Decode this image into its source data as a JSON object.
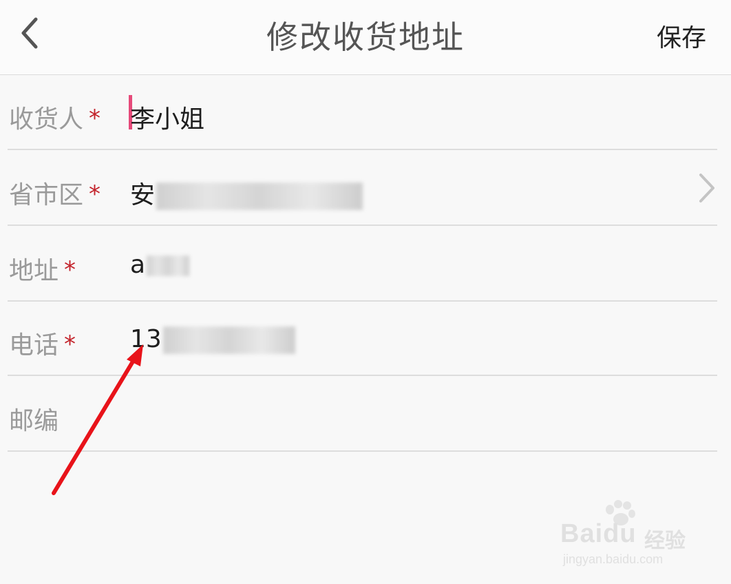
{
  "header": {
    "title": "修改收货地址",
    "save_label": "保存",
    "back_icon": "chevron-left-icon"
  },
  "form": {
    "required_mark": "*",
    "fields": [
      {
        "label": "收货人",
        "required": true,
        "value": "李小姐"
      },
      {
        "label": "省市区",
        "required": true,
        "value": "安",
        "has_chevron": true
      },
      {
        "label": "地址",
        "required": true,
        "value": "a"
      },
      {
        "label": "电话",
        "required": true,
        "value": "13"
      },
      {
        "label": "邮编",
        "required": false,
        "value": ""
      }
    ]
  },
  "watermark": {
    "logo": "Baidu",
    "cn": "经验",
    "url": "jingyan.baidu.com"
  },
  "colors": {
    "accent_caret": "#e64a7a",
    "required": "#c3232b",
    "annotation_arrow": "#e8131a"
  }
}
